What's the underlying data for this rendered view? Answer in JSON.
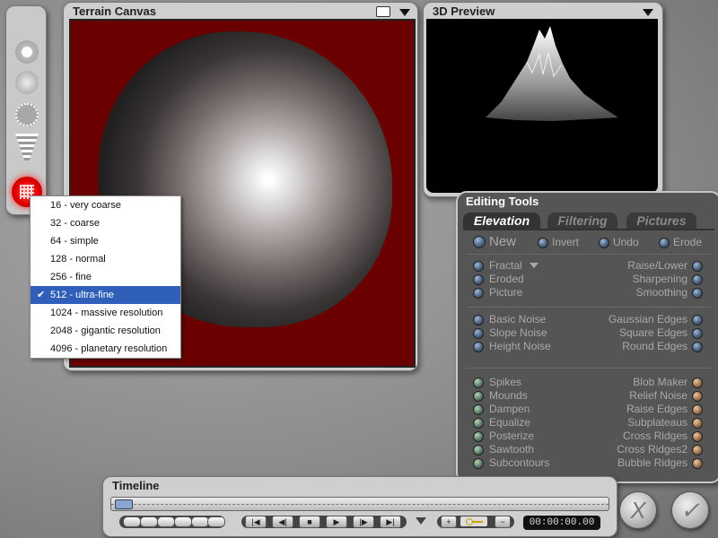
{
  "terrain_canvas": {
    "title": "Terrain Canvas"
  },
  "preview": {
    "title": "3D Preview"
  },
  "resolution_menu": {
    "items": [
      {
        "label": "16 - very coarse",
        "selected": false
      },
      {
        "label": "32 - coarse",
        "selected": false
      },
      {
        "label": "64 - simple",
        "selected": false
      },
      {
        "label": "128 - normal",
        "selected": false
      },
      {
        "label": "256 - fine",
        "selected": false
      },
      {
        "label": "512 - ultra-fine",
        "selected": true
      },
      {
        "label": "1024 - massive resolution",
        "selected": false
      },
      {
        "label": "2048 - gigantic resolution",
        "selected": false
      },
      {
        "label": "4096 - planetary resolution",
        "selected": false
      }
    ],
    "check_mark": "✔"
  },
  "editing_tools": {
    "title": "Editing Tools",
    "tabs": [
      "Elevation",
      "Filtering",
      "Pictures"
    ],
    "actions": {
      "new": "New",
      "invert": "Invert",
      "undo": "Undo",
      "erode": "Erode"
    },
    "group1_left": [
      "Fractal",
      "Eroded",
      "Picture"
    ],
    "group1_right": [
      "Raise/Lower",
      "Sharpening",
      "Smoothing"
    ],
    "group2_left": [
      "Basic Noise",
      "Slope Noise",
      "Height Noise"
    ],
    "group2_right": [
      "Gaussian Edges",
      "Square Edges",
      "Round Edges"
    ],
    "group3_left": [
      "Spikes",
      "Mounds",
      "Dampen",
      "Equalize",
      "Posterize",
      "Sawtooth",
      "Subcontours"
    ],
    "group3_right": [
      "Blob Maker",
      "Relief Noise",
      "Raise Edges",
      "Subplateaus",
      "Cross Ridges",
      "Cross Ridges2",
      "Bubble Ridges"
    ]
  },
  "timeline": {
    "title": "Timeline",
    "timecode": "00:00:00.00",
    "add": "+",
    "remove": "−"
  },
  "buttons": {
    "cancel": "X",
    "accept": "✓"
  },
  "colors": {
    "canvas_bg": "#6b0000",
    "selected_menu": "#2f5fb8"
  }
}
